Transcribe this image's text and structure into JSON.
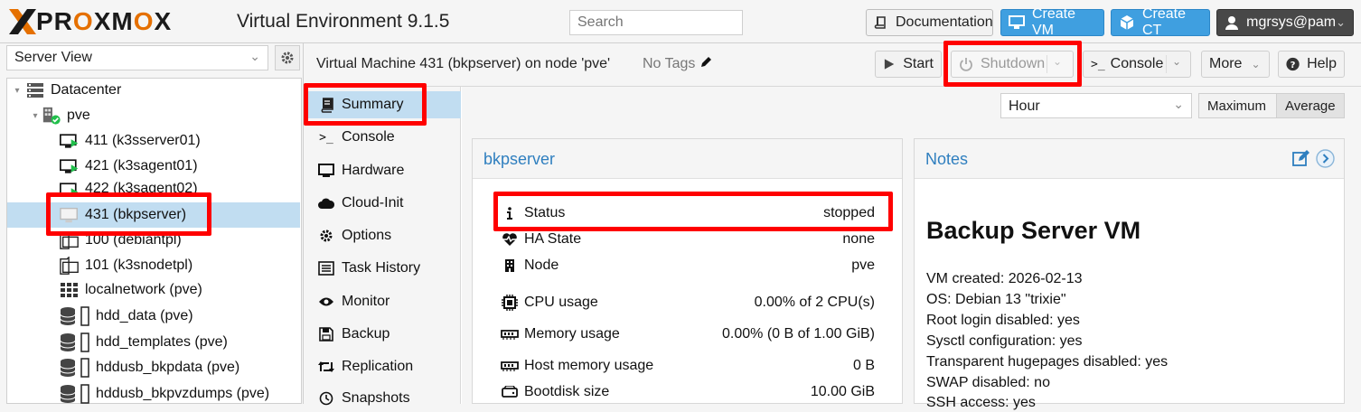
{
  "header": {
    "logo_text_1": "PR",
    "logo_o": "O",
    "logo_text_2": "XM",
    "logo_o2": "O",
    "logo_text_3": "X",
    "product": "Virtual Environment 9.1.5",
    "search_placeholder": "Search",
    "doc_label": "Documentation",
    "create_vm_label": "Create VM",
    "create_ct_label": "Create CT",
    "user_label": "mgrsys@pam",
    "accent_color": "#3f9fe0",
    "brand_color": "#e57000"
  },
  "left": {
    "view_select": "Server View",
    "tree": [
      {
        "label": "Datacenter",
        "icon": "datacenter-icon"
      },
      {
        "label": "pve",
        "icon": "node-online-icon"
      },
      {
        "label": "411 (k3sserver01)",
        "icon": "vm-running-icon"
      },
      {
        "label": "421 (k3sagent01)",
        "icon": "vm-running-icon"
      },
      {
        "label": "422 (k3sagent02)",
        "icon": "vm-running-icon"
      },
      {
        "label": "431 (bkpserver)",
        "icon": "vm-stopped-icon"
      },
      {
        "label": "100 (debiantpl)",
        "icon": "template-icon"
      },
      {
        "label": "101 (k3snodetpl)",
        "icon": "template-icon"
      },
      {
        "label": "localnetwork (pve)",
        "icon": "network-icon"
      },
      {
        "label": "hdd_data (pve)",
        "icon": "storage-icon"
      },
      {
        "label": "hdd_templates (pve)",
        "icon": "storage-icon"
      },
      {
        "label": "hddusb_bkpdata (pve)",
        "icon": "storage-icon"
      },
      {
        "label": "hddusb_bkpvzdumps (pve)",
        "icon": "storage-icon"
      }
    ]
  },
  "toolbar": {
    "title": "Virtual Machine 431 (bkpserver) on node 'pve'",
    "tags": "No Tags",
    "start": "Start",
    "shutdown": "Shutdown",
    "console": "Console",
    "more": "More",
    "help": "Help"
  },
  "nav": [
    {
      "label": "Summary",
      "icon": "book-icon"
    },
    {
      "label": "Console",
      "icon": "terminal-icon"
    },
    {
      "label": "Hardware",
      "icon": "monitor-icon"
    },
    {
      "label": "Cloud-Init",
      "icon": "cloud-icon"
    },
    {
      "label": "Options",
      "icon": "gear-icon"
    },
    {
      "label": "Task History",
      "icon": "list-icon"
    },
    {
      "label": "Monitor",
      "icon": "eye-icon"
    },
    {
      "label": "Backup",
      "icon": "floppy-icon"
    },
    {
      "label": "Replication",
      "icon": "retweet-icon"
    },
    {
      "label": "Snapshots",
      "icon": "history-icon"
    }
  ],
  "range": {
    "selected": "Hour",
    "maximum": "Maximum",
    "average": "Average"
  },
  "summary": {
    "title": "bkpserver",
    "rows": [
      {
        "label": "Status",
        "value": "stopped",
        "icon": "info-icon"
      },
      {
        "label": "HA State",
        "value": "none",
        "icon": "heartbeat-icon"
      },
      {
        "label": "Node",
        "value": "pve",
        "icon": "building-icon"
      },
      {
        "label": "CPU usage",
        "value": "0.00% of 2 CPU(s)",
        "icon": "cpu-icon"
      },
      {
        "label": "Memory usage",
        "value": "0.00% (0 B of 1.00 GiB)",
        "icon": "memory-icon"
      },
      {
        "label": "Host memory usage",
        "value": "0 B",
        "icon": "memory-icon"
      },
      {
        "label": "Bootdisk size",
        "value": "10.00 GiB",
        "icon": "hdd-icon"
      }
    ]
  },
  "notes": {
    "title": "Notes",
    "heading": "Backup Server VM",
    "lines": [
      "VM created: 2026-02-13",
      "OS: Debian 13 \"trixie\"",
      "Root login disabled: yes",
      "Sysctl configuration: yes",
      "Transparent hugepages disabled: yes",
      "SWAP disabled: no",
      "SSH access: yes"
    ]
  }
}
